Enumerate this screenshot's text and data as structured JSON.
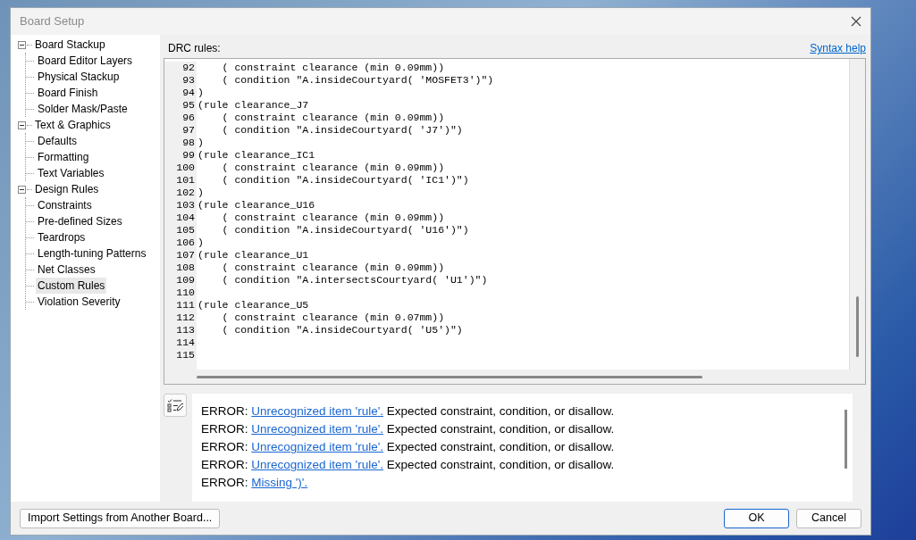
{
  "window": {
    "title": "Board Setup"
  },
  "tree": [
    {
      "label": "Board Stackup",
      "expanded": true,
      "selected": false,
      "children": [
        {
          "label": "Board Editor Layers",
          "selected": false
        },
        {
          "label": "Physical Stackup",
          "selected": false
        },
        {
          "label": "Board Finish",
          "selected": false
        },
        {
          "label": "Solder Mask/Paste",
          "selected": false
        }
      ]
    },
    {
      "label": "Text & Graphics",
      "expanded": true,
      "selected": false,
      "children": [
        {
          "label": "Defaults",
          "selected": false
        },
        {
          "label": "Formatting",
          "selected": false
        },
        {
          "label": "Text Variables",
          "selected": false
        }
      ]
    },
    {
      "label": "Design Rules",
      "expanded": true,
      "selected": false,
      "children": [
        {
          "label": "Constraints",
          "selected": false
        },
        {
          "label": "Pre-defined Sizes",
          "selected": false
        },
        {
          "label": "Teardrops",
          "selected": false
        },
        {
          "label": "Length-tuning Patterns",
          "selected": false
        },
        {
          "label": "Net Classes",
          "selected": false
        },
        {
          "label": "Custom Rules",
          "selected": true
        },
        {
          "label": "Violation Severity",
          "selected": false
        }
      ]
    }
  ],
  "editor": {
    "label": "DRC rules:",
    "help_link": "Syntax help",
    "lines": [
      {
        "number": "92",
        "text": "    ( constraint clearance (min 0.09mm))"
      },
      {
        "number": "93",
        "text": "    ( condition \"A.insideCourtyard( 'MOSFET3')\")"
      },
      {
        "number": "94",
        "text": ")"
      },
      {
        "number": "95",
        "text": "(rule clearance_J7"
      },
      {
        "number": "96",
        "text": "    ( constraint clearance (min 0.09mm))"
      },
      {
        "number": "97",
        "text": "    ( condition \"A.insideCourtyard( 'J7')\")"
      },
      {
        "number": "98",
        "text": ")"
      },
      {
        "number": "99",
        "text": "(rule clearance_IC1"
      },
      {
        "number": "100",
        "text": "    ( constraint clearance (min 0.09mm))"
      },
      {
        "number": "101",
        "text": "    ( condition \"A.insideCourtyard( 'IC1')\")"
      },
      {
        "number": "102",
        "text": ")"
      },
      {
        "number": "103",
        "text": "(rule clearance_U16"
      },
      {
        "number": "104",
        "text": "    ( constraint clearance (min 0.09mm))"
      },
      {
        "number": "105",
        "text": "    ( condition \"A.insideCourtyard( 'U16')\")"
      },
      {
        "number": "106",
        "text": ")"
      },
      {
        "number": "107",
        "text": "(rule clearance_U1"
      },
      {
        "number": "108",
        "text": "    ( constraint clearance (min 0.09mm))"
      },
      {
        "number": "109",
        "text": "    ( condition \"A.intersectsCourtyard( 'U1')\")"
      },
      {
        "number": "110"
      },
      {
        "number": "111",
        "text": "(rule clearance_U5"
      },
      {
        "number": "112",
        "text": "    ( constraint clearance (min 0.07mm))"
      },
      {
        "number": "113",
        "text": "    ( condition \"A.insideCourtyard( 'U5')\")"
      },
      {
        "number": "114"
      },
      {
        "number": "115"
      }
    ]
  },
  "errors": [
    {
      "prefix": "ERROR:",
      "link": "Unrecognized item 'rule'.",
      "message": "Expected constraint, condition, or disallow."
    },
    {
      "prefix": "ERROR:",
      "link": "Unrecognized item 'rule'.",
      "message": "Expected constraint, condition, or disallow."
    },
    {
      "prefix": "ERROR:",
      "link": "Unrecognized item 'rule'.",
      "message": "Expected constraint, condition, or disallow."
    },
    {
      "prefix": "ERROR:",
      "link": "Unrecognized item 'rule'.",
      "message": "Expected constraint, condition, or disallow."
    },
    {
      "prefix": "ERROR:",
      "link": "Missing ')'."
    }
  ],
  "buttons": {
    "import": "Import Settings from Another Board...",
    "ok": "OK",
    "cancel": "Cancel"
  }
}
